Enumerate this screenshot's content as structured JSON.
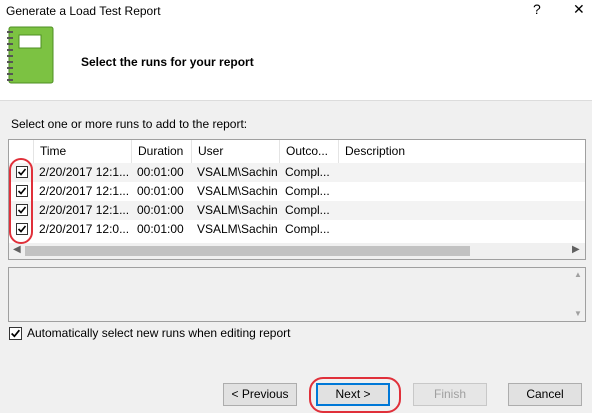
{
  "window": {
    "title": "Generate a Load Test Report",
    "help_glyph": "?",
    "close_glyph": "✕"
  },
  "header": {
    "title": "Select the runs for your report",
    "icon": "notebook-icon"
  },
  "prompt": "Select one or more runs to add to the report:",
  "table": {
    "columns": [
      "Time",
      "Duration",
      "User",
      "Outco...",
      "Description"
    ],
    "rows": [
      {
        "checked": true,
        "time": "2/20/2017 12:1...",
        "duration": "00:01:00",
        "user": "VSALM\\Sachin",
        "outcome": "Compl...",
        "description": ""
      },
      {
        "checked": true,
        "time": "2/20/2017 12:1...",
        "duration": "00:01:00",
        "user": "VSALM\\Sachin",
        "outcome": "Compl...",
        "description": ""
      },
      {
        "checked": true,
        "time": "2/20/2017 12:1...",
        "duration": "00:01:00",
        "user": "VSALM\\Sachin",
        "outcome": "Compl...",
        "description": ""
      },
      {
        "checked": true,
        "time": "2/20/2017 12:0...",
        "duration": "00:01:00",
        "user": "VSALM\\Sachin",
        "outcome": "Compl...",
        "description": ""
      }
    ]
  },
  "auto_select": {
    "checked": true,
    "label": "Automatically select new runs when editing report"
  },
  "buttons": {
    "previous": "< Previous",
    "next": "Next >",
    "finish": "Finish",
    "cancel": "Cancel"
  },
  "colors": {
    "highlight": "#e0303a",
    "accent": "#0078d7",
    "notebook": "#7cc242"
  }
}
